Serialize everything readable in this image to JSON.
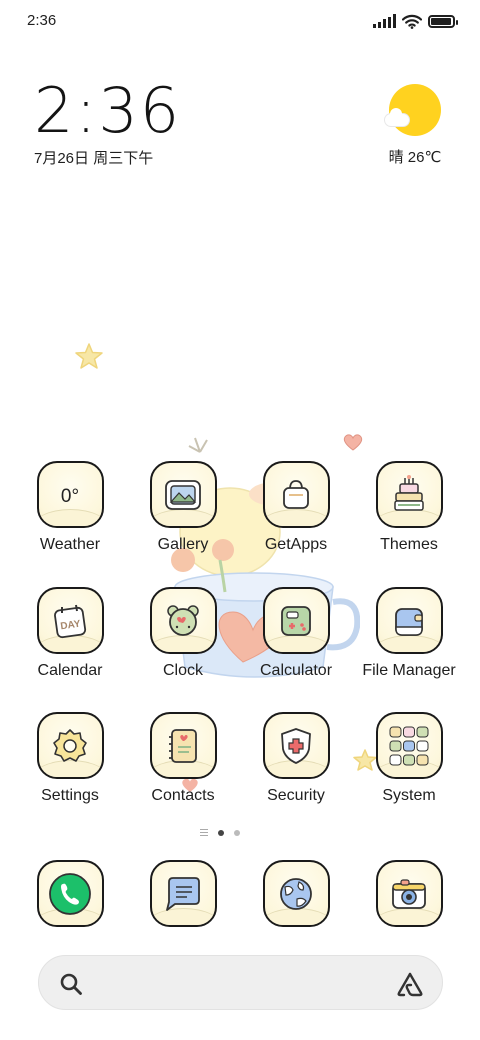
{
  "status_bar": {
    "time": "2:36",
    "icons": [
      "signal-icon",
      "wifi-icon",
      "battery-icon"
    ],
    "battery_level": 0.9
  },
  "clock_widget": {
    "time": "2:36",
    "date": "7月26日 周三下午"
  },
  "weather_widget": {
    "icon": "sun-cloud-icon",
    "text": "晴 26℃"
  },
  "apps": [
    {
      "label": "Weather",
      "icon": "weather-icon",
      "icon_text": "0°"
    },
    {
      "label": "Gallery",
      "icon": "gallery-icon"
    },
    {
      "label": "GetApps",
      "icon": "shopping-bag-icon"
    },
    {
      "label": "Themes",
      "icon": "cake-icon"
    },
    {
      "label": "Calendar",
      "icon": "calendar-icon",
      "icon_text": "DAY"
    },
    {
      "label": "Clock",
      "icon": "alarm-clock-icon"
    },
    {
      "label": "Calculator",
      "icon": "calculator-icon"
    },
    {
      "label": "File Manager",
      "icon": "folder-icon"
    },
    {
      "label": "Settings",
      "icon": "gear-icon"
    },
    {
      "label": "Contacts",
      "icon": "notebook-icon"
    },
    {
      "label": "Security",
      "icon": "shield-icon"
    },
    {
      "label": "System",
      "icon": "folder-grid-icon"
    }
  ],
  "dock": [
    {
      "icon": "phone-icon"
    },
    {
      "icon": "message-icon"
    },
    {
      "icon": "browser-icon"
    },
    {
      "icon": "camera-icon"
    }
  ],
  "page_indicator": {
    "pages": 2,
    "current_page": 1
  },
  "search_bar": {
    "search_icon": "search-icon",
    "assistant_icon": "assistant-icon",
    "placeholder": ""
  },
  "colors": {
    "icon_border": "#1a1a1a",
    "icon_background": "#fdf7dc",
    "sun": "#ffd21f",
    "phone_green": "#1cc06a",
    "message_blue": "#a9c6ef"
  }
}
